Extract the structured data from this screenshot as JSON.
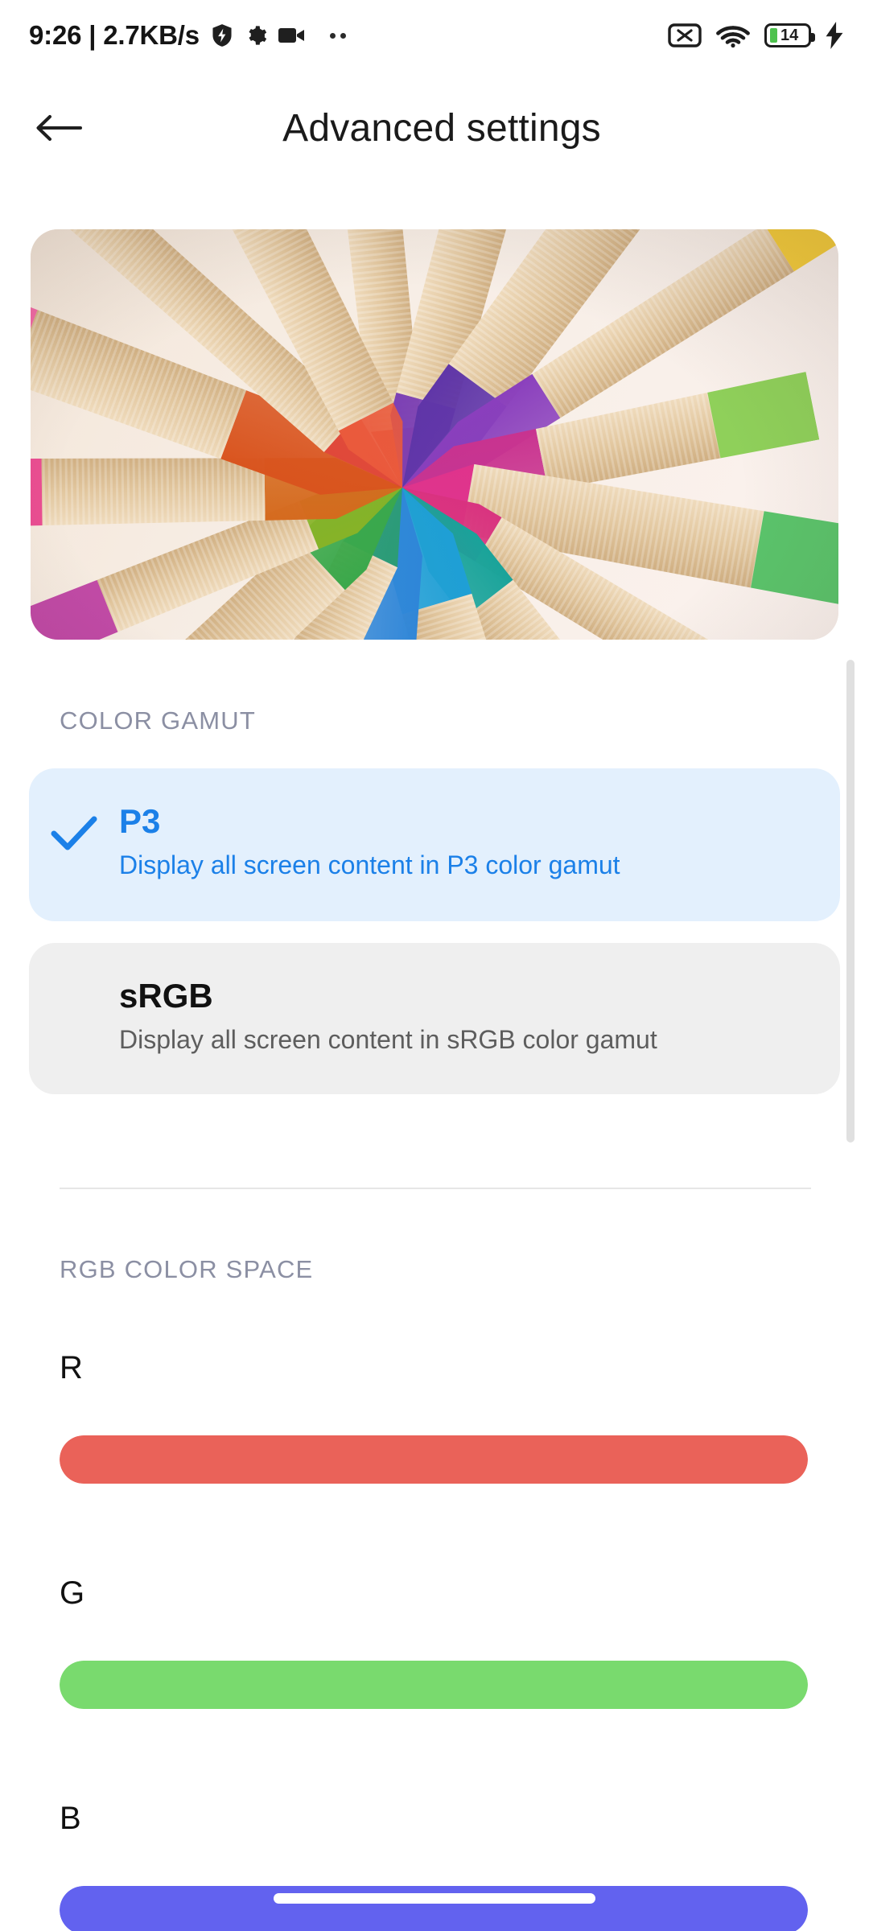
{
  "statusbar": {
    "clock": "9:26",
    "separator": "|",
    "network_speed": "2.7KB/s",
    "left_icons": [
      {
        "name": "shield-icon",
        "glyph": "shield"
      },
      {
        "name": "gear-icon",
        "glyph": "gear"
      },
      {
        "name": "video-camera-icon",
        "glyph": "camera"
      },
      {
        "name": "more-dots-icon",
        "glyph": "dots"
      }
    ],
    "right_icons": [
      {
        "name": "sim-card-off-icon",
        "glyph": "sim-x"
      },
      {
        "name": "wifi-icon",
        "glyph": "wifi"
      }
    ],
    "battery": {
      "level_text": "14",
      "charging": true,
      "fill_color": "#4ec24e"
    }
  },
  "appbar": {
    "back_label": "back",
    "title": "Advanced settings"
  },
  "preview": {
    "alt": "colored pencils arranged in a radial color wheel",
    "name": "color-preview-image"
  },
  "sections": {
    "color_gamut_label": "COLOR GAMUT",
    "rgb_color_space_label": "RGB COLOR SPACE"
  },
  "gamut_options": [
    {
      "id": "p3",
      "title": "P3",
      "subtitle": "Display all screen content in P3 color gamut",
      "selected": true,
      "bg_color": "#e3f0fd",
      "text_color": "#1b80e8"
    },
    {
      "id": "srgb",
      "title": "sRGB",
      "subtitle": "Display all screen content in sRGB color gamut",
      "selected": false,
      "bg_color": "#efefef",
      "text_color": "#111111"
    }
  ],
  "rgb_sliders": [
    {
      "id": "r",
      "label": "R",
      "color": "#ea6259",
      "fill_percent": 100
    },
    {
      "id": "g",
      "label": "G",
      "color": "#79da6e",
      "fill_percent": 100
    },
    {
      "id": "b",
      "label": "B",
      "color": "#6262ef",
      "fill_percent": 100
    }
  ],
  "scrollbar": {
    "name": "vertical-scrollbar",
    "color": "#e0e0e0"
  },
  "navigation": {
    "gesture_pill": "home-gesture-bar"
  },
  "colors": {
    "accent_blue": "#1b80e8",
    "selected_card_bg": "#e3f0fd",
    "plain_card_bg": "#efefef",
    "label_gray": "#8b8fa3",
    "page_bg": "#ffffff"
  }
}
